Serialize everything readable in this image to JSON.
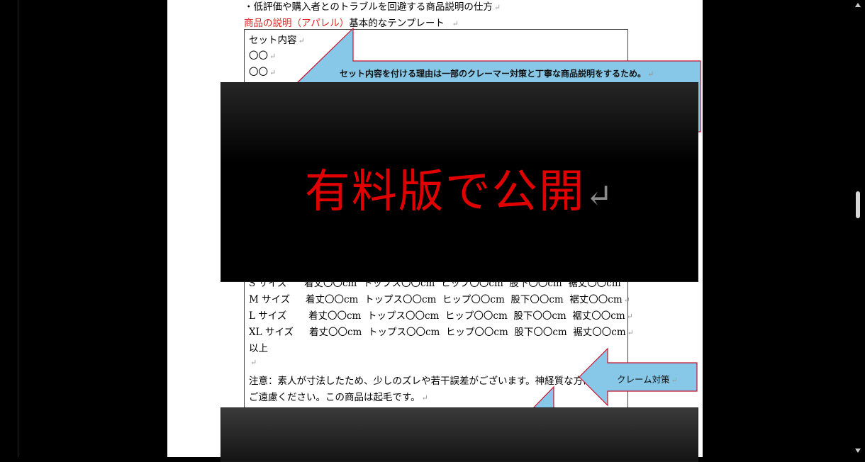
{
  "doc": {
    "heading": "・低評価や購入者とのトラブルを回避する商品説明の仕方",
    "template_red": "商品の説明（アパレル）",
    "template_rest": "基本的なテンプレート",
    "set_title": "セット内容",
    "set_item1": "〇〇",
    "set_item2": "〇〇",
    "sizes": [
      {
        "size": "S サイズ",
        "spec": "着丈〇〇cm  トップス〇〇cm  ヒップ〇〇cm  股下〇〇cm  裾丈〇〇cm"
      },
      {
        "size": "M サイズ",
        "spec": "着丈〇〇cm  トップス〇〇cm  ヒップ〇〇cm  股下〇〇cm  裾丈〇〇cm"
      },
      {
        "size": "L サイズ",
        "spec": "着丈〇〇cm  トップス〇〇cm  ヒップ〇〇cm  股下〇〇cm  裾丈〇〇cm"
      },
      {
        "size": "XL サイズ",
        "spec": "着丈〇〇cm  トップス〇〇cm  ヒップ〇〇cm  股下〇〇cm  裾丈〇〇cm"
      }
    ],
    "end": "以上",
    "note1": "注意：素人が寸法したため、少しのズレや若干誤差がございます。神経質な方は",
    "note2": "ご遠慮ください。この商品は起毛です。"
  },
  "callouts": {
    "set_reason": "セット内容を付ける理由は一部のクレーマー対策と丁寧な商品説明をするため。",
    "claim": "クレーム対策"
  },
  "overlay": {
    "text": "有料版で公開"
  },
  "marks": {
    "paragraph": "↵"
  },
  "colors": {
    "callout_fill": "#87c8e8",
    "callout_border": "#c8102e",
    "red_text": "#e00000"
  }
}
